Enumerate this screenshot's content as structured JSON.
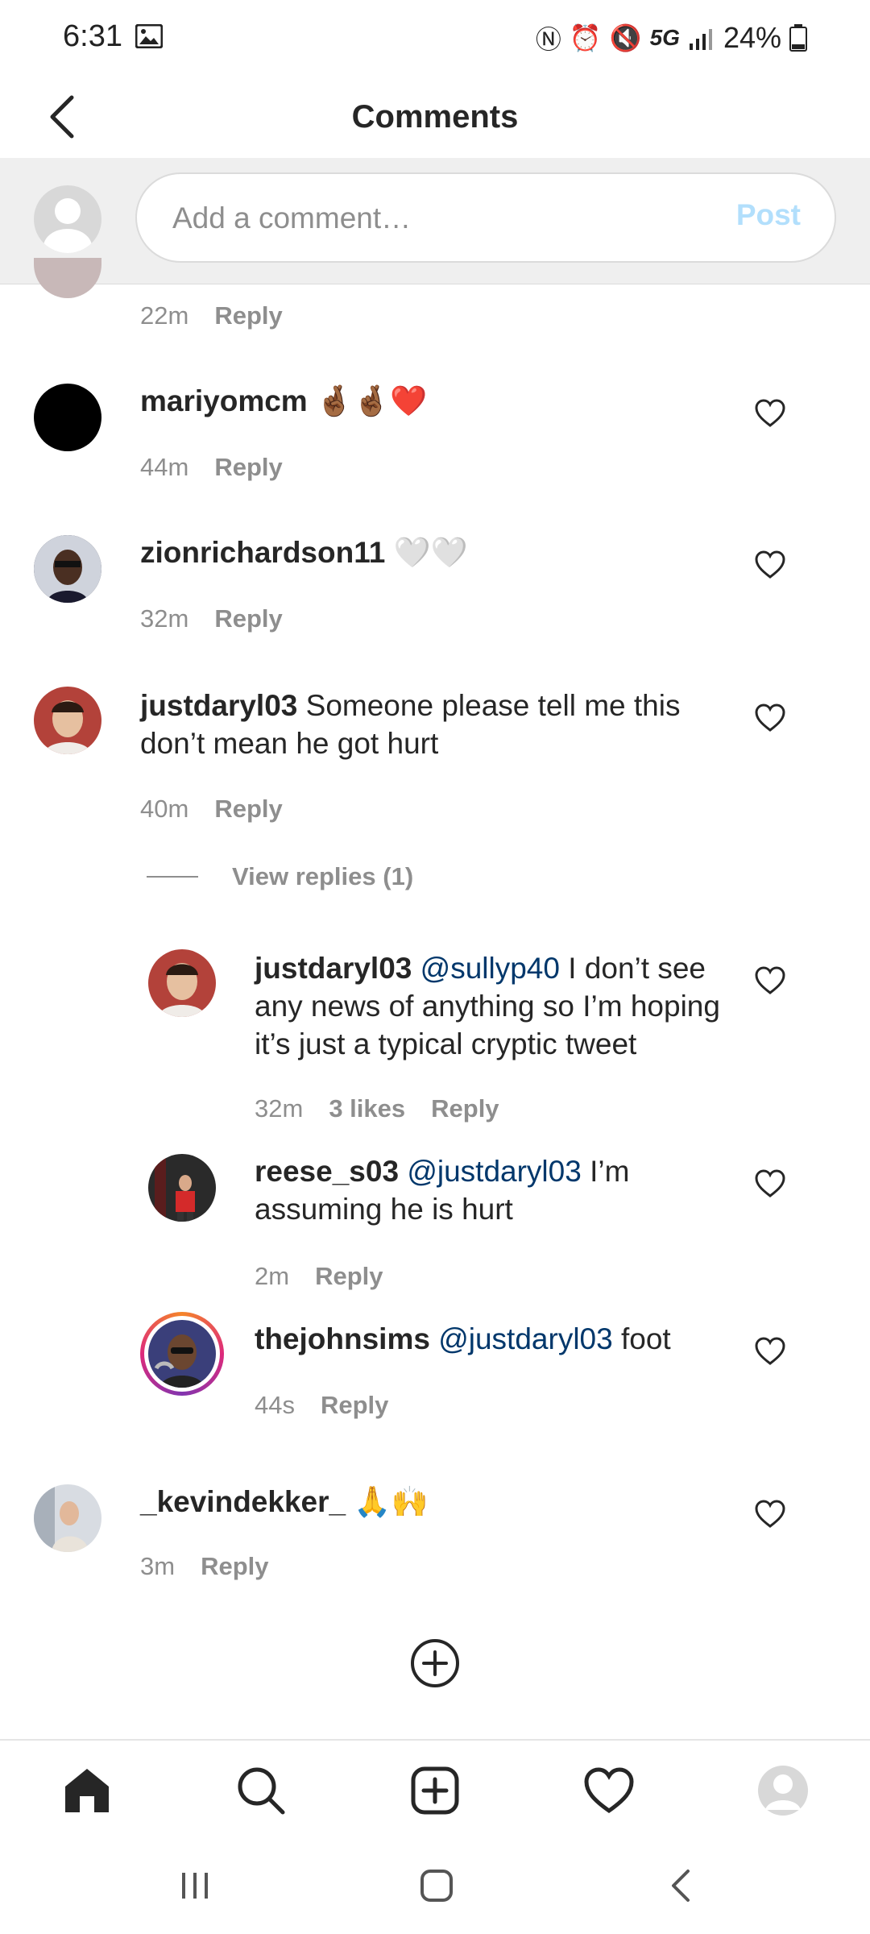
{
  "status_bar": {
    "time": "6:31",
    "network": "5G",
    "battery": "24%"
  },
  "header": {
    "title": "Comments"
  },
  "input": {
    "placeholder": "Add a comment…",
    "post_label": "Post"
  },
  "comments": [
    {
      "time": "22m",
      "reply": "Reply"
    },
    {
      "username": "mariyomcm",
      "text": "🤞🏾🤞🏾❤️",
      "time": "44m",
      "reply": "Reply"
    },
    {
      "username": "zionrichardson11",
      "text": "🤍🤍",
      "time": "32m",
      "reply": "Reply"
    },
    {
      "username": "justdaryl03",
      "text": "Someone please tell me this",
      "text2": "don’t mean he got hurt",
      "time": "40m",
      "reply": "Reply"
    },
    {
      "username": "_kevindekker_",
      "text": "🙏🙌",
      "time": "3m",
      "reply": "Reply"
    }
  ],
  "view_replies": "View replies (1)",
  "replies": [
    {
      "username": "justdaryl03",
      "mention": "@sullyp40",
      "text": "I don’t see",
      "text2": "any news of anything so I’m hoping",
      "text3": "it’s just a typical cryptic tweet",
      "time": "32m",
      "likes": "3 likes",
      "reply": "Reply"
    },
    {
      "username": "reese_s03",
      "mention": "@justdaryl03",
      "text": "I’m",
      "text2": "assuming he is hurt",
      "time": "2m",
      "reply": "Reply"
    },
    {
      "username": "thejohnsims",
      "mention": "@justdaryl03",
      "text": "foot",
      "time": "44s",
      "reply": "Reply"
    }
  ],
  "icons": {
    "back": "chevron-left-icon",
    "heart": "heart-outline-icon",
    "add": "plus-circle-icon",
    "home": "home-icon",
    "search": "search-icon",
    "new_post": "plus-square-icon",
    "activity": "heart-icon",
    "profile": "profile-icon"
  },
  "colors": {
    "text": "#262626",
    "secondary": "#8e8e8e",
    "mention": "#00376b",
    "post_disabled": "#b2dffc"
  }
}
